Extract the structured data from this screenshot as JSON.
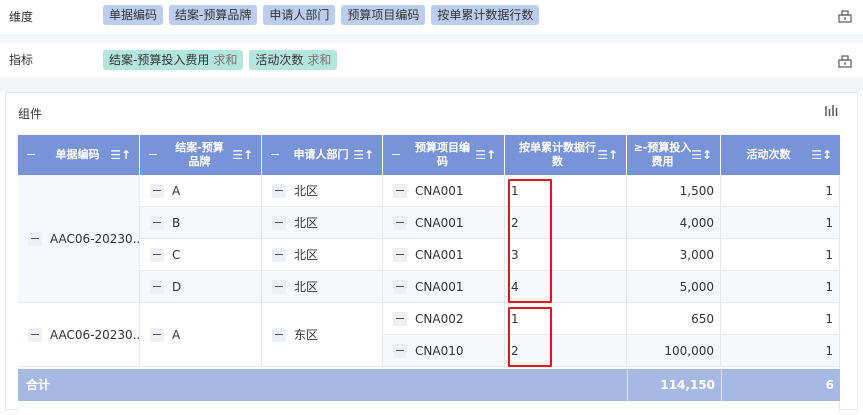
{
  "dimension": {
    "label": "维度",
    "chips": [
      "单据编码",
      "结案-预算品牌",
      "申请人部门",
      "预算项目编码",
      "按单累计数据行数"
    ]
  },
  "indicator": {
    "label": "指标",
    "chips": [
      {
        "name": "结案-预算投入费用",
        "agg": "求和"
      },
      {
        "name": "活动次数",
        "agg": "求和"
      }
    ]
  },
  "panel": {
    "title": "组件"
  },
  "table": {
    "headers": [
      {
        "line1": "单据编码",
        "line2": ""
      },
      {
        "line1": "结案-预算",
        "line2": "品牌"
      },
      {
        "line1": "申请人部门",
        "line2": ""
      },
      {
        "line1": "预算项目编",
        "line2": "码"
      },
      {
        "line1": "按单累计数据行",
        "line2": "数"
      },
      {
        "line1": "≥-预算投入",
        "line2": "费用"
      },
      {
        "line1": "活动次数",
        "line2": ""
      }
    ],
    "groups": [
      {
        "doc": "AAC06-20230...",
        "rows": [
          {
            "brand": "A",
            "dept": "北区",
            "proj": "CNA001",
            "count": "1",
            "cost": "1,500",
            "times": "1"
          },
          {
            "brand": "B",
            "dept": "北区",
            "proj": "CNA001",
            "count": "2",
            "cost": "4,000",
            "times": "1"
          },
          {
            "brand": "C",
            "dept": "北区",
            "proj": "CNA001",
            "count": "3",
            "cost": "3,000",
            "times": "1"
          },
          {
            "brand": "D",
            "dept": "北区",
            "proj": "CNA001",
            "count": "4",
            "cost": "5,000",
            "times": "1"
          }
        ]
      },
      {
        "doc": "AAC06-20230...",
        "brand": "A",
        "dept": "东区",
        "rows": [
          {
            "proj": "CNA002",
            "count": "1",
            "cost": "650",
            "times": "1"
          },
          {
            "proj": "CNA010",
            "count": "2",
            "cost": "100,000",
            "times": "1"
          }
        ]
      }
    ],
    "total": {
      "label": "合计",
      "cost": "114,150",
      "times": "6"
    }
  },
  "colors": {
    "header": "#7794d9",
    "total": "#a6b9e5",
    "highlight": "#d9191c",
    "chip_dim": "#bccdf0",
    "chip_ind": "#b5e6de"
  }
}
